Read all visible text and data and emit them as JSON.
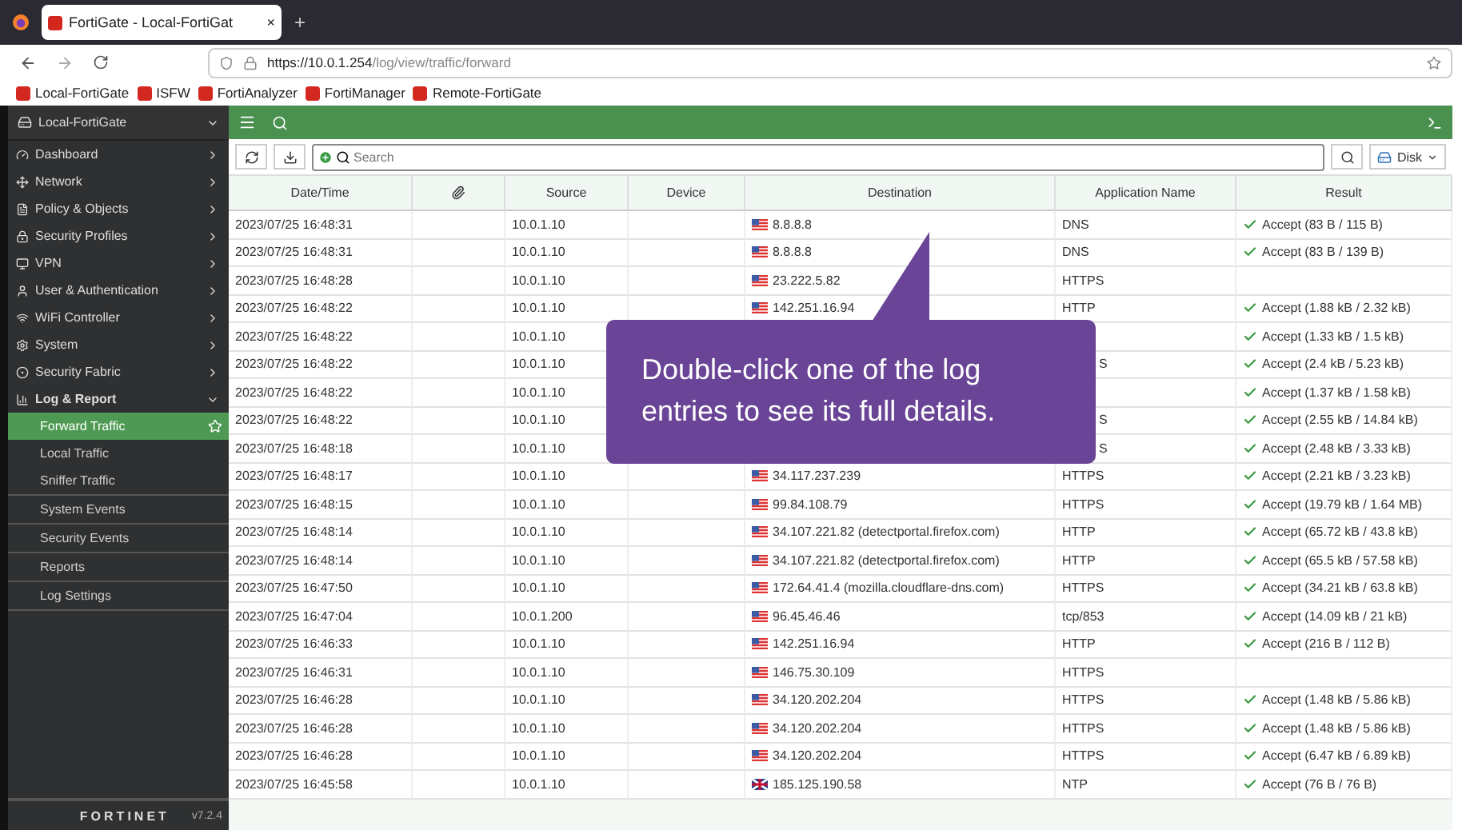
{
  "browser": {
    "tab_title": "FortiGate - Local-FortiGat",
    "tab_close": "×",
    "new_tab": "+",
    "url_host": "https://10.0.1.254",
    "url_path": "/log/view/traffic/forward",
    "bookmarks": [
      "Local-FortiGate",
      "ISFW",
      "FortiAnalyzer",
      "FortiManager",
      "Remote-FortiGate"
    ]
  },
  "sidebar": {
    "device": "Local-FortiGate",
    "items": [
      {
        "label": "Dashboard",
        "expanded": false
      },
      {
        "label": "Network",
        "expanded": false
      },
      {
        "label": "Policy & Objects",
        "expanded": false
      },
      {
        "label": "Security Profiles",
        "expanded": false
      },
      {
        "label": "VPN",
        "expanded": false
      },
      {
        "label": "User & Authentication",
        "expanded": false
      },
      {
        "label": "WiFi Controller",
        "expanded": false
      },
      {
        "label": "System",
        "expanded": false
      },
      {
        "label": "Security Fabric",
        "expanded": false
      },
      {
        "label": "Log & Report",
        "expanded": true,
        "children": [
          {
            "label": "Forward Traffic",
            "selected": true
          },
          {
            "label": "Local Traffic",
            "selected": false
          },
          {
            "label": "Sniffer Traffic",
            "selected": false
          },
          {
            "label": "System Events",
            "selected": false
          },
          {
            "label": "Security Events",
            "selected": false
          },
          {
            "label": "Reports",
            "selected": false
          },
          {
            "label": "Log Settings",
            "selected": false
          }
        ]
      }
    ],
    "brand": "FORTINET",
    "version": "v7.2.4"
  },
  "toolbar": {
    "search_placeholder": "Search",
    "disk": "Disk"
  },
  "table": {
    "columns": [
      "Date/Time",
      "",
      "Source",
      "Device",
      "Destination",
      "Application Name",
      "Result"
    ],
    "rows": [
      {
        "time": "2023/07/25 16:48:31",
        "source": "10.0.1.10",
        "flag": {
          "kind": "us"
        },
        "destination": "8.8.8.8",
        "app": "DNS",
        "result": "Accept (83 B / 115 B)"
      },
      {
        "time": "2023/07/25 16:48:31",
        "source": "10.0.1.10",
        "flag": {
          "kind": "us"
        },
        "destination": "8.8.8.8",
        "app": "DNS",
        "result": "Accept (83 B / 139 B)"
      },
      {
        "time": "2023/07/25 16:48:28",
        "source": "10.0.1.10",
        "flag": {
          "kind": "us"
        },
        "destination": "23.222.5.82",
        "app": "HTTPS",
        "result": ""
      },
      {
        "time": "2023/07/25 16:48:22",
        "source": "10.0.1.10",
        "flag": {
          "kind": "us"
        },
        "destination": "142.251.16.94",
        "app": "HTTP",
        "result": "Accept (1.88 kB / 2.32 kB)"
      },
      {
        "time": "2023/07/25 16:48:22",
        "source": "10.0.1.10",
        "covered": true,
        "app": "",
        "result": "Accept (1.33 kB / 1.5 kB)"
      },
      {
        "time": "2023/07/25 16:48:22",
        "source": "10.0.1.10",
        "covered": true,
        "app": "S",
        "result": "Accept (2.4 kB / 5.23 kB)"
      },
      {
        "time": "2023/07/25 16:48:22",
        "source": "10.0.1.10",
        "covered": true,
        "app": "",
        "result": "Accept (1.37 kB / 1.58 kB)"
      },
      {
        "time": "2023/07/25 16:48:22",
        "source": "10.0.1.10",
        "covered": true,
        "app": "S",
        "result": "Accept (2.55 kB / 14.84 kB)"
      },
      {
        "time": "2023/07/25 16:48:18",
        "source": "10.0.1.10",
        "covered": true,
        "app": "S",
        "result": "Accept (2.48 kB / 3.33 kB)"
      },
      {
        "time": "2023/07/25 16:48:17",
        "source": "10.0.1.10",
        "flag": {
          "kind": "us"
        },
        "destination": "34.117.237.239",
        "app": "HTTPS",
        "result": "Accept (2.21 kB / 3.23 kB)"
      },
      {
        "time": "2023/07/25 16:48:15",
        "source": "10.0.1.10",
        "flag": {
          "kind": "us"
        },
        "destination": "99.84.108.79",
        "app": "HTTPS",
        "result": "Accept (19.79 kB / 1.64 MB)"
      },
      {
        "time": "2023/07/25 16:48:14",
        "source": "10.0.1.10",
        "flag": {
          "kind": "us"
        },
        "destination": "34.107.221.82 (detectportal.firefox.com)",
        "app": "HTTP",
        "result": "Accept (65.72 kB / 43.8 kB)"
      },
      {
        "time": "2023/07/25 16:48:14",
        "source": "10.0.1.10",
        "flag": {
          "kind": "us"
        },
        "destination": "34.107.221.82 (detectportal.firefox.com)",
        "app": "HTTP",
        "result": "Accept (65.5 kB / 57.58 kB)"
      },
      {
        "time": "2023/07/25 16:47:50",
        "source": "10.0.1.10",
        "flag": {
          "kind": "us"
        },
        "destination": "172.64.41.4 (mozilla.cloudflare-dns.com)",
        "app": "HTTPS",
        "result": "Accept (34.21 kB / 63.8 kB)"
      },
      {
        "time": "2023/07/25 16:47:04",
        "source": "10.0.1.200",
        "flag": {
          "kind": "us"
        },
        "destination": "96.45.46.46",
        "app": "tcp/853",
        "result": "Accept (14.09 kB / 21 kB)"
      },
      {
        "time": "2023/07/25 16:46:33",
        "source": "10.0.1.10",
        "flag": {
          "kind": "us"
        },
        "destination": "142.251.16.94",
        "app": "HTTP",
        "result": "Accept (216 B / 112 B)"
      },
      {
        "time": "2023/07/25 16:46:31",
        "source": "10.0.1.10",
        "flag": {
          "kind": "us"
        },
        "destination": "146.75.30.109",
        "app": "HTTPS",
        "result": ""
      },
      {
        "time": "2023/07/25 16:46:28",
        "source": "10.0.1.10",
        "flag": {
          "kind": "us"
        },
        "destination": "34.120.202.204",
        "app": "HTTPS",
        "result": "Accept (1.48 kB / 5.86 kB)"
      },
      {
        "time": "2023/07/25 16:46:28",
        "source": "10.0.1.10",
        "flag": {
          "kind": "us"
        },
        "destination": "34.120.202.204",
        "app": "HTTPS",
        "result": "Accept (1.48 kB / 5.86 kB)"
      },
      {
        "time": "2023/07/25 16:46:28",
        "source": "10.0.1.10",
        "flag": {
          "kind": "us"
        },
        "destination": "34.120.202.204",
        "app": "HTTPS",
        "result": "Accept (6.47 kB / 6.89 kB)"
      },
      {
        "time": "2023/07/25 16:45:58",
        "source": "10.0.1.10",
        "flag": {
          "kind": "uk"
        },
        "destination": "185.125.190.58",
        "app": "NTP",
        "result": "Accept (76 B / 76 B)"
      }
    ]
  },
  "callout": {
    "text": "Double-click one of the log entries to see its full details."
  }
}
